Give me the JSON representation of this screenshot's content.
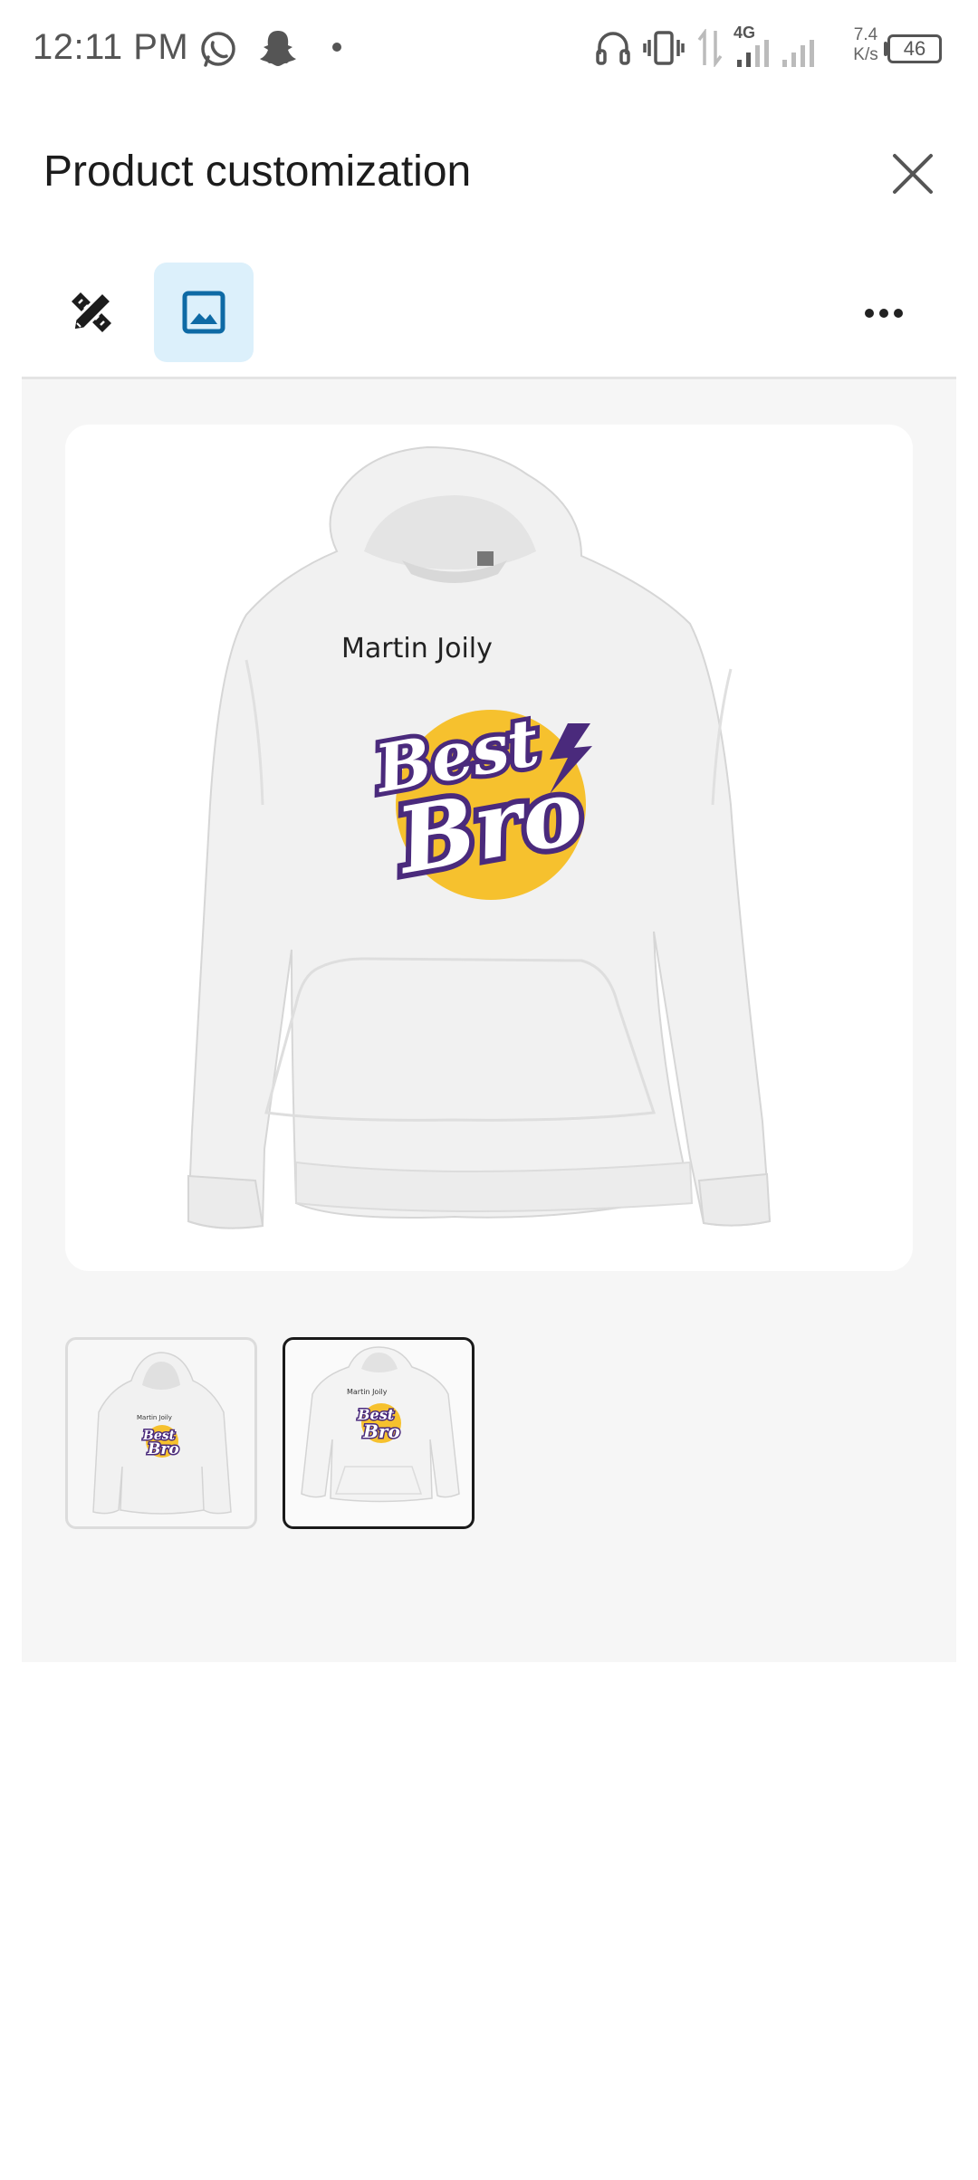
{
  "status_bar": {
    "time": "12:11 PM",
    "network": "4G",
    "speed_value": "7.4",
    "speed_unit": "K/s",
    "battery": "46",
    "icons": [
      "whatsapp-icon",
      "snapchat-icon",
      "dot-icon",
      "headphones-icon",
      "vibrate-icon",
      "data-arrows-icon",
      "signal-icon",
      "signal-icon-2",
      "battery-icon"
    ]
  },
  "header": {
    "title": "Product customization",
    "close_icon": "close-icon"
  },
  "toolbar": {
    "tools": [
      {
        "name": "design-tools",
        "icon": "pencil-ruler-icon",
        "active": false
      },
      {
        "name": "image",
        "icon": "image-icon",
        "active": true
      }
    ],
    "more_icon": "more-horizontal-icon",
    "active_color": "#dcf0fb",
    "active_icon_color": "#0e6aa5"
  },
  "preview": {
    "product": "hoodie",
    "print_name": "Martin Joily",
    "logo_line1": "Best",
    "logo_line2": "Bro",
    "logo_circle_color": "#f6c12e",
    "logo_outline_color": "#4a2a7c"
  },
  "thumbnails": [
    {
      "name": "front-view",
      "selected": false
    },
    {
      "name": "flat-view",
      "selected": true
    }
  ]
}
